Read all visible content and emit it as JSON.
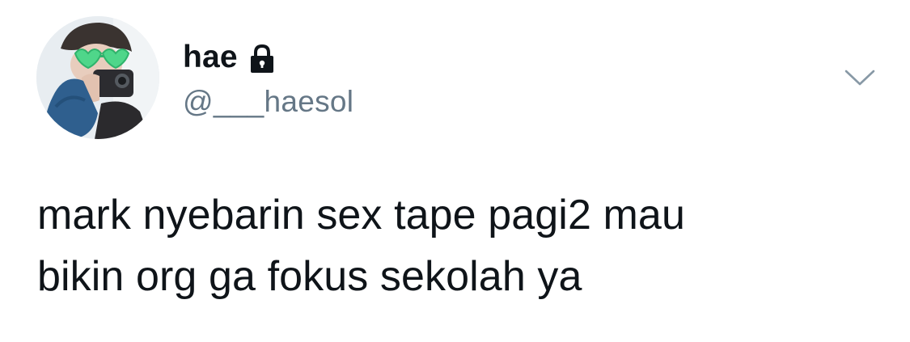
{
  "tweet": {
    "author": {
      "display_name": "hae",
      "handle": "@___haesol",
      "protected_icon": "lock-icon",
      "avatar_icon": "profile-photo"
    },
    "menu_icon": "chevron-down-icon",
    "text_lines": [
      "mark nyebarin sex tape pagi2 mau",
      "bikin org ga fokus sekolah ya"
    ]
  },
  "colors": {
    "text_primary": "#0f1419",
    "text_secondary": "#657786",
    "caret": "#8899a6",
    "background": "#ffffff"
  }
}
